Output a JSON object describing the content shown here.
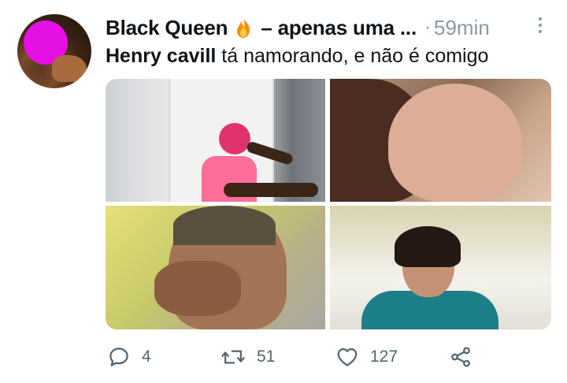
{
  "tweet": {
    "author_name": "Black Queen",
    "author_suffix": "– apenas uma ...",
    "author_emoji": "fire-emoji",
    "separator": "·",
    "time": "59min",
    "text_bold": "Henry cavill",
    "text_rest": " tá namorando, e não é comigo"
  },
  "media": [
    {
      "name": "media-image-1",
      "icon": "photo"
    },
    {
      "name": "media-image-2",
      "icon": "photo"
    },
    {
      "name": "media-image-3",
      "icon": "photo"
    },
    {
      "name": "media-image-4",
      "icon": "photo"
    }
  ],
  "actions": {
    "reply_count": "4",
    "retweet_count": "51",
    "like_count": "127"
  },
  "colors": {
    "text": "#0f1419",
    "muted": "#536471",
    "avatar_blur": "#e60fe6"
  }
}
